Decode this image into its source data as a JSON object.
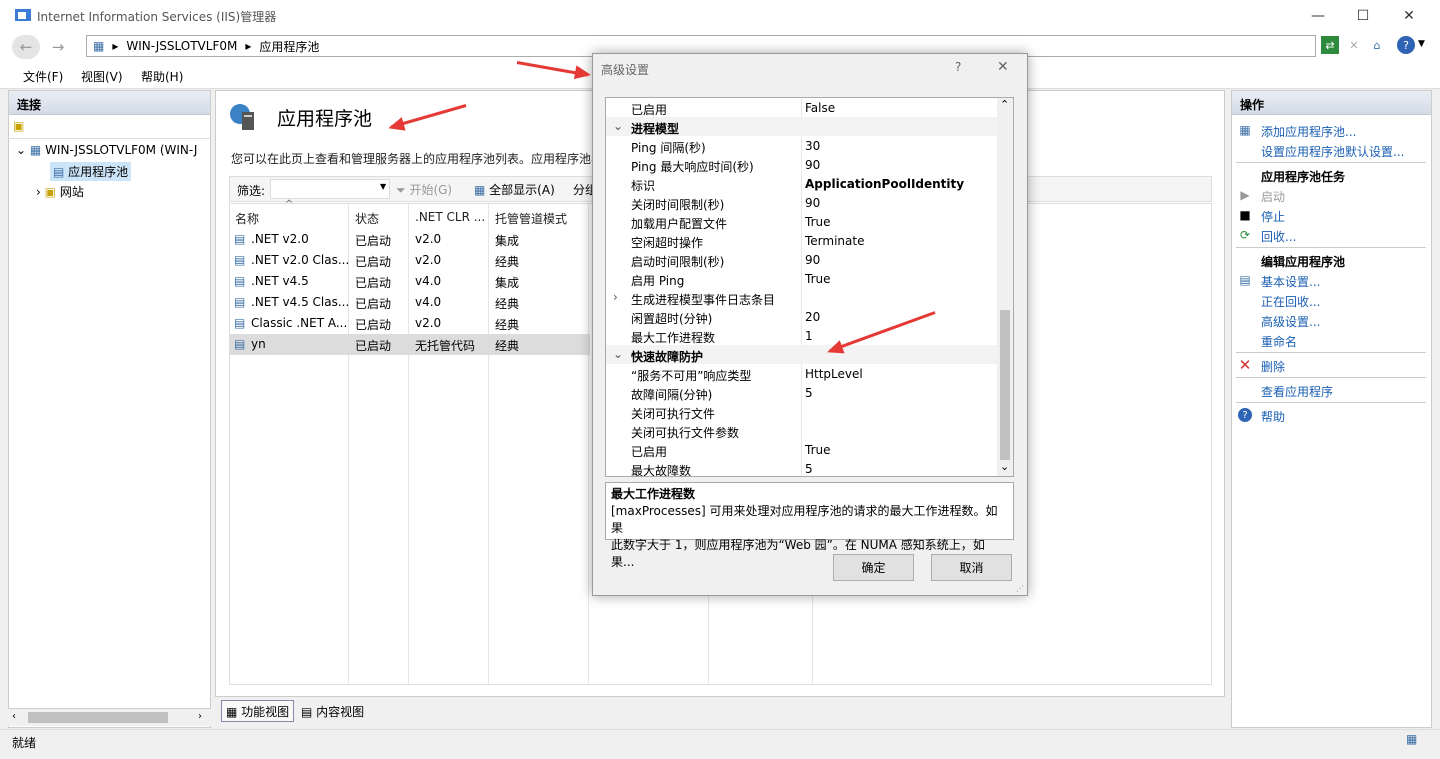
{
  "window": {
    "title": "Internet Information Services (IIS)管理器"
  },
  "address": {
    "segments": [
      "WIN-JSSLOTVLF0M",
      "应用程序池"
    ]
  },
  "menu": [
    "文件(F)",
    "视图(V)",
    "帮助(H)"
  ],
  "left": {
    "header": "连接",
    "tree": {
      "server": "WIN-JSSLOTVLF0M (WIN-J",
      "apppools": "应用程序池",
      "sites": "网站"
    }
  },
  "center": {
    "title": "应用程序池",
    "description": "您可以在此页上查看和管理服务器上的应用程序池列表。应用程序池与",
    "filter": {
      "label": "筛选:",
      "start": "开始(G)",
      "showall": "全部显示(A)",
      "group": "分组"
    },
    "columns": [
      "名称",
      "状态",
      ".NET CLR ...",
      "托管管道模式"
    ],
    "rows": [
      {
        "name": ".NET v2.0",
        "status": "已启动",
        "clr": "v2.0",
        "mode": "集成"
      },
      {
        "name": ".NET v2.0 Clas...",
        "status": "已启动",
        "clr": "v2.0",
        "mode": "经典"
      },
      {
        "name": ".NET v4.5",
        "status": "已启动",
        "clr": "v4.0",
        "mode": "集成"
      },
      {
        "name": ".NET v4.5 Clas...",
        "status": "已启动",
        "clr": "v4.0",
        "mode": "经典"
      },
      {
        "name": "Classic .NET A...",
        "status": "已启动",
        "clr": "v2.0",
        "mode": "经典"
      },
      {
        "name": "yn",
        "status": "已启动",
        "clr": "无托管代码",
        "mode": "经典"
      }
    ],
    "tabs": {
      "feature": "功能视图",
      "content": "内容视图"
    }
  },
  "right": {
    "header": "操作",
    "add": "添加应用程序池...",
    "defaults": "设置应用程序池默认设置...",
    "tasks_header": "应用程序池任务",
    "start": "启动",
    "stop": "停止",
    "recycle": "回收...",
    "edit_header": "编辑应用程序池",
    "basic": "基本设置...",
    "recycling": "正在回收...",
    "advanced": "高级设置...",
    "rename": "重命名",
    "delete": "删除",
    "viewapps": "查看应用程序",
    "help": "帮助"
  },
  "status": {
    "text": "就绪"
  },
  "dialog": {
    "title": "高级设置",
    "help": "?",
    "properties": [
      {
        "name": "已启用",
        "value": "False"
      },
      {
        "name": "进程模型",
        "value": "",
        "category": true
      },
      {
        "name": "Ping 间隔(秒)",
        "value": "30"
      },
      {
        "name": "Ping 最大响应时间(秒)",
        "value": "90"
      },
      {
        "name": "标识",
        "value": "ApplicationPoolIdentity",
        "bold": true
      },
      {
        "name": "关闭时间限制(秒)",
        "value": "90"
      },
      {
        "name": "加载用户配置文件",
        "value": "True"
      },
      {
        "name": "空闲超时操作",
        "value": "Terminate"
      },
      {
        "name": "启动时间限制(秒)",
        "value": "90"
      },
      {
        "name": "启用 Ping",
        "value": "True"
      },
      {
        "name": "生成进程模型事件日志条目",
        "value": "",
        "expandable": true
      },
      {
        "name": "闲置超时(分钟)",
        "value": "20"
      },
      {
        "name": "最大工作进程数",
        "value": "1"
      },
      {
        "name": "快速故障防护",
        "value": "",
        "category": true
      },
      {
        "name": "“服务不可用”响应类型",
        "value": "HttpLevel"
      },
      {
        "name": "故障间隔(分钟)",
        "value": "5"
      },
      {
        "name": "关闭可执行文件",
        "value": ""
      },
      {
        "name": "关闭可执行文件参数",
        "value": ""
      },
      {
        "name": "已启用",
        "value": "True"
      },
      {
        "name": "最大故障数",
        "value": "5"
      }
    ],
    "desc_title": "最大工作进程数",
    "desc_line1": "[maxProcesses] 可用来处理对应用程序池的请求的最大工作进程数。如果",
    "desc_line2": "此数字大于 1，则应用程序池为“Web 园”。在 NUMA 感知系统上，如果...",
    "ok": "确定",
    "cancel": "取消"
  }
}
